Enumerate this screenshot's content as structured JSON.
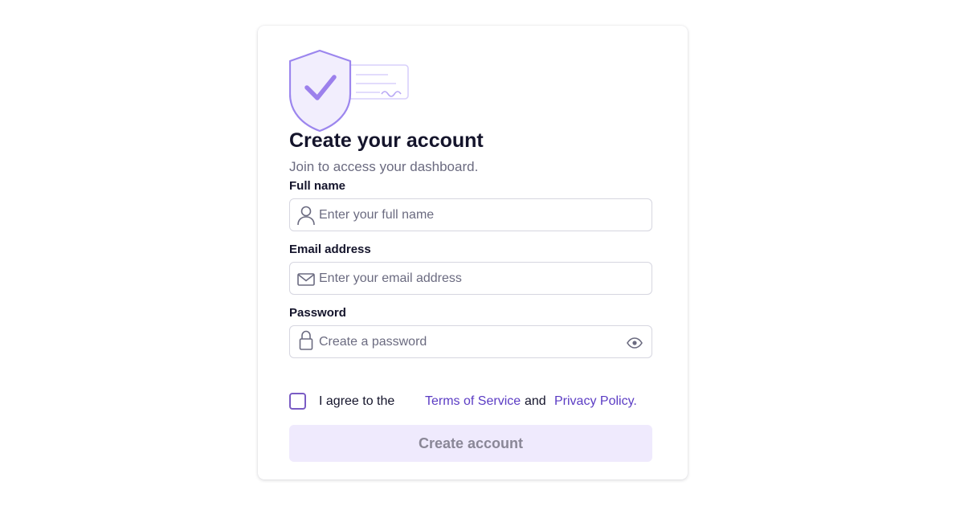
{
  "header": {
    "title": "Create your account",
    "subtitle": "Join to access your dashboard."
  },
  "form": {
    "full_name": {
      "label": "Full name",
      "placeholder": "Enter your full name",
      "value": "",
      "icon": "user-icon"
    },
    "email": {
      "label": "Email address",
      "placeholder": "Enter your email address",
      "value": "",
      "icon": "envelope-icon"
    },
    "password": {
      "label": "Password",
      "placeholder": "Create a password",
      "value": "",
      "icon": "lock-icon",
      "toggle_icon": "eye-icon"
    },
    "agreement": {
      "prefix": "I agree to the",
      "terms_link": "Terms of Service",
      "conjunction": "and",
      "privacy_link": "Privacy Policy.",
      "checked": false
    },
    "submit_label": "Create account"
  },
  "illustration": {
    "icon": "shield-check-icon"
  },
  "colors": {
    "accent": "#5b3cc4",
    "accent_light": "#efeafd",
    "shield_stroke": "#9c86ee",
    "shield_fill": "#f2eefd",
    "text_primary": "#14142b",
    "text_muted": "#6b6b80",
    "border": "#d6d6e0"
  }
}
